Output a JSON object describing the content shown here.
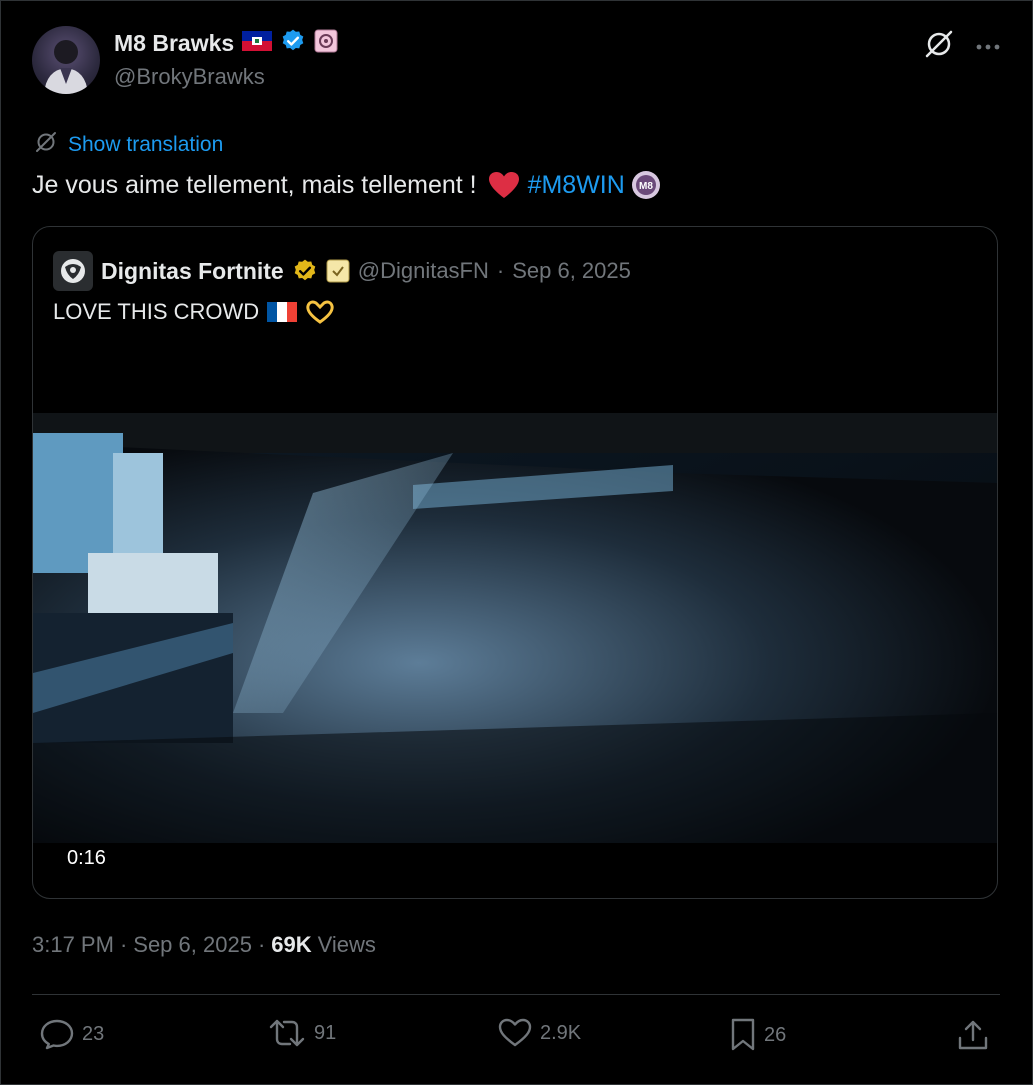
{
  "author": {
    "display_name": "M8 Brawks",
    "handle": "@BrokyBrawks"
  },
  "translation": {
    "label": "Show translation"
  },
  "tweet": {
    "text": "Je vous aime tellement, mais tellement ! ",
    "hashtag": "#M8WIN"
  },
  "quote": {
    "display_name": "Dignitas Fortnite",
    "handle": "@DignitasFN",
    "date": "Sep 6, 2025",
    "separator": "·",
    "text": "LOVE THIS CROWD",
    "video_duration": "0:16"
  },
  "meta": {
    "time": "3:17 PM",
    "date": "Sep 6, 2025",
    "views_count": "69K",
    "views_label": "Views",
    "separator": "·"
  },
  "actions": {
    "replies": "23",
    "reposts": "91",
    "likes": "2.9K",
    "bookmarks": "26"
  },
  "colors": {
    "background": "#000000",
    "link": "#1d9bf0",
    "verified": "#1d9bf0",
    "gold_verified": "#e2b719",
    "heart": "#e0245e"
  }
}
